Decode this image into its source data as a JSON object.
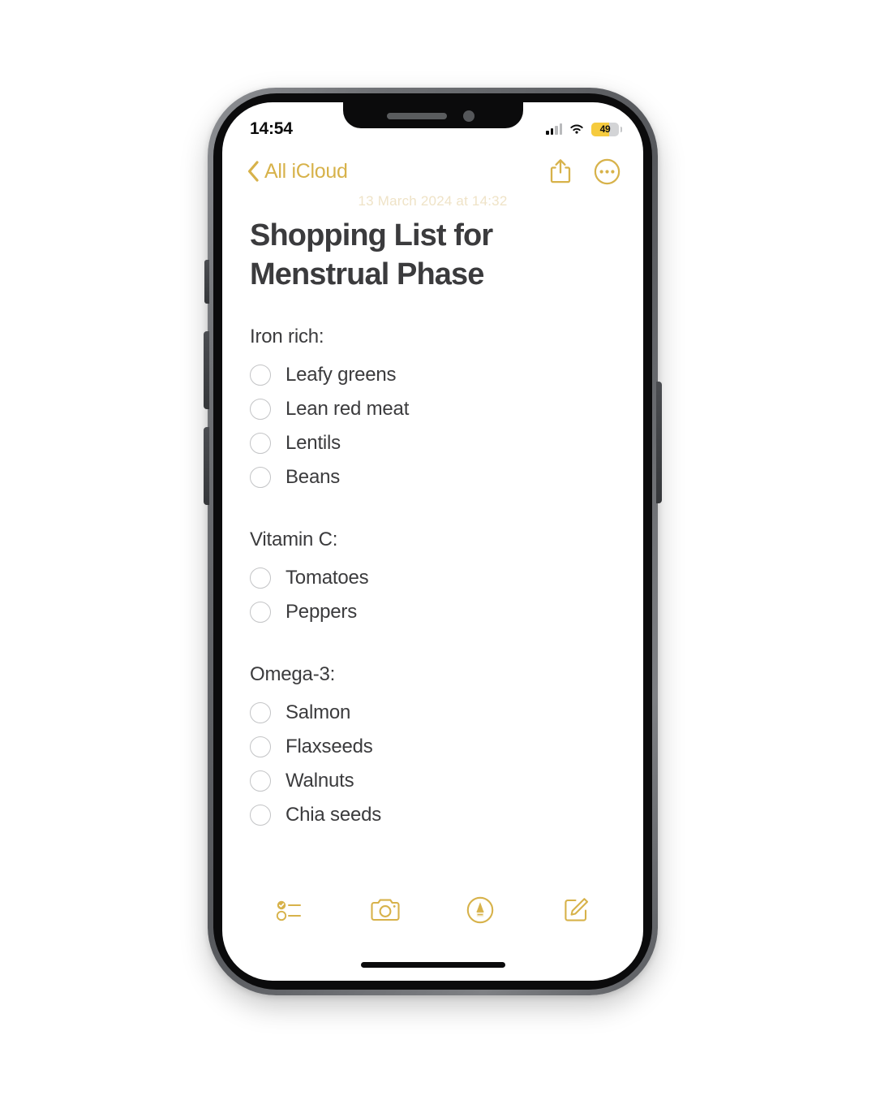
{
  "status_bar": {
    "time": "14:54",
    "cellular_icon": "cellular-bars-icon",
    "wifi_icon": "wifi-icon",
    "battery_level": "49",
    "battery_icon": "battery-icon",
    "battery_color": "#f6cb3e"
  },
  "nav": {
    "back_label": "All iCloud",
    "back_icon": "chevron-left-icon",
    "share_icon": "share-icon",
    "more_icon": "ellipsis-circle-icon",
    "accent_color": "#d7b24a"
  },
  "note": {
    "date": "13 March 2024 at 14:32",
    "title": "Shopping List for Menstrual Phase",
    "sections": [
      {
        "label": "Iron rich:",
        "items": [
          {
            "text": "Leafy greens",
            "checked": false
          },
          {
            "text": "Lean red meat",
            "checked": false
          },
          {
            "text": "Lentils",
            "checked": false
          },
          {
            "text": "Beans",
            "checked": false
          }
        ]
      },
      {
        "label": "Vitamin C:",
        "items": [
          {
            "text": "Tomatoes",
            "checked": false
          },
          {
            "text": "Peppers",
            "checked": false
          }
        ]
      },
      {
        "label": "Omega-3:",
        "items": [
          {
            "text": "Salmon",
            "checked": false
          },
          {
            "text": "Flaxseeds",
            "checked": false
          },
          {
            "text": "Walnuts",
            "checked": false
          },
          {
            "text": "Chia seeds",
            "checked": false
          }
        ]
      }
    ]
  },
  "toolbar": {
    "items": [
      {
        "icon": "checklist-icon",
        "name": "checklist-button"
      },
      {
        "icon": "camera-icon",
        "name": "camera-button"
      },
      {
        "icon": "markup-pen-icon",
        "name": "markup-button"
      },
      {
        "icon": "compose-icon",
        "name": "compose-button"
      }
    ]
  },
  "device": {
    "home_indicator": "home-indicator",
    "buttons": [
      "mute-switch",
      "volume-up-button",
      "volume-down-button",
      "power-button"
    ]
  }
}
